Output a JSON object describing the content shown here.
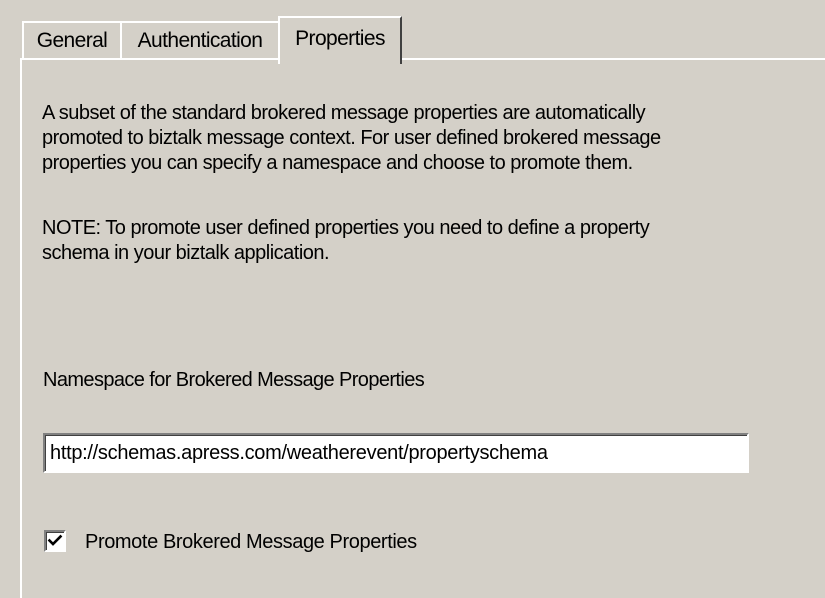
{
  "tabs": [
    {
      "label": "General",
      "selected": false
    },
    {
      "label": "Authentication",
      "selected": false
    },
    {
      "label": "Properties",
      "selected": true
    }
  ],
  "description": {
    "lines": [
      "A subset of the standard brokered message properties  are automatically",
      "promoted to biztalk message context.  For user defined brokered message",
      "properties you can  specify a namespace and choose to promote them."
    ]
  },
  "note": {
    "lines": [
      "NOTE: To promote user defined properties you need to  define a property",
      "schema in your biztalk application."
    ]
  },
  "namespace": {
    "label": "Namespace for Brokered Message Properties",
    "value": "http://schemas.apress.com/weatherevent/propertyschema"
  },
  "promote": {
    "label": "Promote Brokered Message Properties",
    "checked": true
  }
}
